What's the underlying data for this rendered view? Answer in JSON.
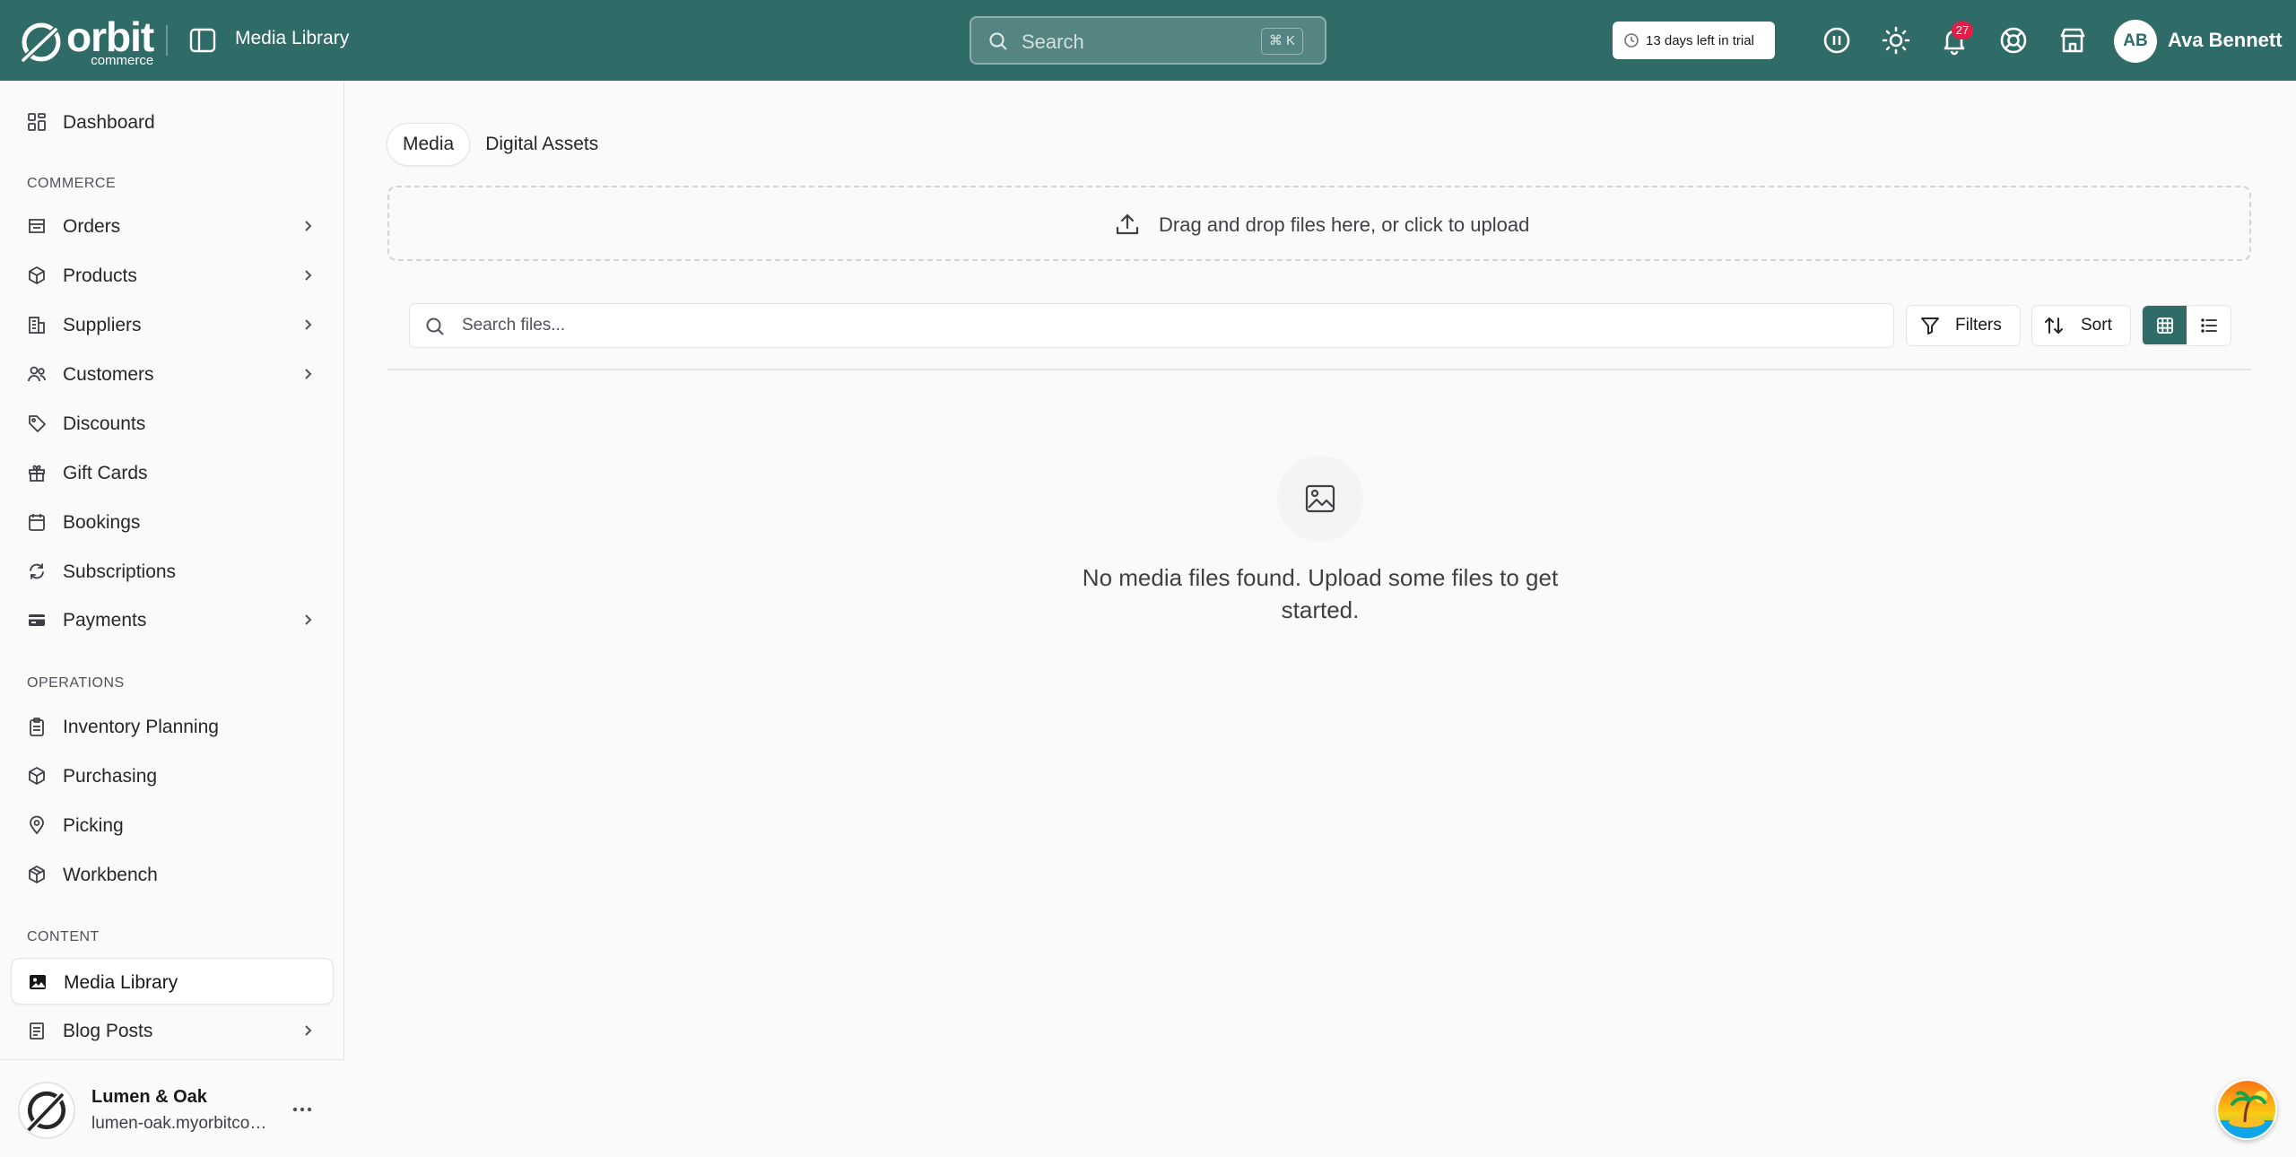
{
  "brand": {
    "name": "orbit",
    "sub": "commerce"
  },
  "topbar": {
    "page_title": "Media Library",
    "search_label": "Search",
    "search_shortcut": "⌘ K",
    "trial_text": "13 days left in trial",
    "notification_count": "27",
    "user_initials": "AB",
    "user_name": "Ava Bennett"
  },
  "sidebar": {
    "dashboard": "Dashboard",
    "sections": {
      "commerce": "COMMERCE",
      "operations": "OPERATIONS",
      "content": "CONTENT"
    },
    "commerce_items": [
      {
        "label": "Orders",
        "icon": "orders-icon",
        "has_children": true
      },
      {
        "label": "Products",
        "icon": "package-icon",
        "has_children": true
      },
      {
        "label": "Suppliers",
        "icon": "building-icon",
        "has_children": true
      },
      {
        "label": "Customers",
        "icon": "users-icon",
        "has_children": true
      },
      {
        "label": "Discounts",
        "icon": "tag-icon",
        "has_children": false
      },
      {
        "label": "Gift Cards",
        "icon": "gift-icon",
        "has_children": false
      },
      {
        "label": "Bookings",
        "icon": "calendar-icon",
        "has_children": false
      },
      {
        "label": "Subscriptions",
        "icon": "refresh-icon",
        "has_children": false
      },
      {
        "label": "Payments",
        "icon": "credit-card-icon",
        "has_children": true
      }
    ],
    "operations_items": [
      {
        "label": "Inventory Planning",
        "icon": "clipboard-icon"
      },
      {
        "label": "Purchasing",
        "icon": "package-plus-icon"
      },
      {
        "label": "Picking",
        "icon": "map-pin-icon"
      },
      {
        "label": "Workbench",
        "icon": "box-icon"
      }
    ],
    "content_items": [
      {
        "label": "Media Library",
        "icon": "image-icon",
        "active": true
      },
      {
        "label": "Blog Posts",
        "icon": "document-icon",
        "has_children": true
      }
    ],
    "store": {
      "name": "Lumen & Oak",
      "url": "lumen-oak.myorbitcommerce.com"
    }
  },
  "main": {
    "tabs": [
      {
        "label": "Media",
        "active": true
      },
      {
        "label": "Digital Assets",
        "active": false
      }
    ],
    "dropzone_text": "Drag and drop files here, or click to upload",
    "search_placeholder": "Search files...",
    "filters_label": "Filters",
    "sort_label": "Sort",
    "empty_message": "No media files found. Upload some files to get started."
  },
  "colors": {
    "topbar": "#2f6b67",
    "accent": "#2f6b67",
    "badge": "#e11d48"
  }
}
